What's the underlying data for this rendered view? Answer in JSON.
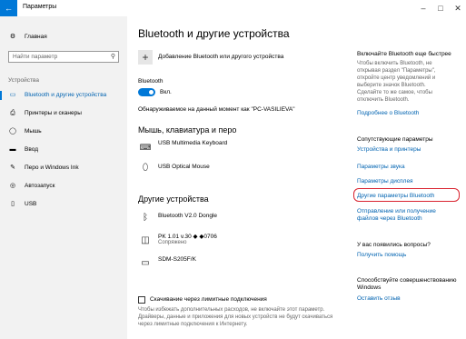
{
  "window": {
    "title": "Параметры",
    "back_glyph": "←",
    "minimize": "–",
    "maximize": "□",
    "close": "✕"
  },
  "sidebar": {
    "home": "Главная",
    "search_placeholder": "Найти параметр",
    "section": "Устройства",
    "items": [
      {
        "label": "Bluetooth и другие устройства",
        "icon": "bluetooth-devices-icon"
      },
      {
        "label": "Принтеры и сканеры",
        "icon": "printer-icon"
      },
      {
        "label": "Мышь",
        "icon": "mouse-icon"
      },
      {
        "label": "Ввод",
        "icon": "keyboard-icon"
      },
      {
        "label": "Перо и Windows Ink",
        "icon": "pen-icon"
      },
      {
        "label": "Автозапуск",
        "icon": "autoplay-icon"
      },
      {
        "label": "USB",
        "icon": "usb-icon"
      }
    ]
  },
  "main": {
    "title": "Bluetooth и другие устройства",
    "add_label": "Добавление Bluetooth или другого устройства",
    "bluetooth_label": "Bluetooth",
    "bluetooth_state": "Вкл.",
    "discoverable": "Обнаруживаемое на данный момент как \"PC-VASILIEVA\"",
    "section_mouse": "Мышь, клавиатура и перо",
    "keyboard": "USB Multimedia Keyboard",
    "mouse": "USB Optical Mouse",
    "section_other": "Другие устройства",
    "dongle": "Bluetooth V2.0 Dongle",
    "pk_name": "PK 1.01 v.30 ◆ ◆0706",
    "pk_status": "Сопряжено",
    "sdm": "SDM-S205F/K",
    "metered_label": "Скачивание через лимитные подключения",
    "metered_desc": "Чтобы избежать дополнительных расходов, не включайте этот параметр. Драйверы, данные и приложения для новых устройств не будут скачиваться через лимитные подключения к Интернету."
  },
  "right": {
    "tip_title": "Включайте Bluetooth еще быстрее",
    "tip_text": "Чтобы включить Bluetooth, не открывая раздел \"Параметры\", откройте центр уведомлений и выберите значок Bluetooth. Сделайте то же самое, чтобы отключить Bluetooth.",
    "tip_link": "Подробнее о Bluetooth",
    "related_title": "Сопутствующие параметры",
    "related_links": [
      "Устройства и принтеры",
      "Параметры звука",
      "Параметры дисплея",
      "Другие параметры Bluetooth",
      "Отправление или получение файлов через Bluetooth"
    ],
    "help_title": "У вас появились вопросы?",
    "help_link": "Получить помощь",
    "improve_title": "Способствуйте совершенствованию Windows",
    "improve_link": "Оставить отзыв"
  },
  "colors": {
    "accent": "#0078d7",
    "link": "#0063b1",
    "highlight": "#d9232f"
  }
}
